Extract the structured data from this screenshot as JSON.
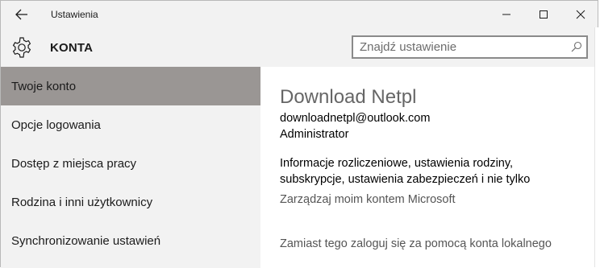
{
  "window": {
    "title": "Ustawienia",
    "back_icon": "arrow-left-icon",
    "minimize_icon": "minimize-icon",
    "maximize_icon": "maximize-icon",
    "close_icon": "close-icon"
  },
  "header": {
    "section_title": "KONTA",
    "section_icon": "gear-icon",
    "search": {
      "placeholder": "Znajdź ustawienie",
      "value": "",
      "icon": "search-icon"
    }
  },
  "sidebar": {
    "items": [
      {
        "label": "Twoje konto",
        "selected": true
      },
      {
        "label": "Opcje logowania",
        "selected": false
      },
      {
        "label": "Dostęp z miejsca pracy",
        "selected": false
      },
      {
        "label": "Rodzina i inni użytkownicy",
        "selected": false
      },
      {
        "label": "Synchronizowanie ustawień",
        "selected": false
      }
    ]
  },
  "account": {
    "name": "Download Netpl",
    "email": "downloadnetpl@outlook.com",
    "role": "Administrator",
    "info": "Informacje rozliczeniowe, ustawienia rodziny, subskrypcje, ustawienia zabezpieczeń i nie tylko",
    "manage_link": "Zarządzaj moim kontem Microsoft",
    "local_link": "Zamiast tego zaloguj się za pomocą konta lokalnego"
  },
  "colors": {
    "chrome_bg": "#f2f2f2",
    "selected_item_bg": "#9a9694",
    "content_bg": "#ffffff",
    "link_color": "#555555"
  }
}
